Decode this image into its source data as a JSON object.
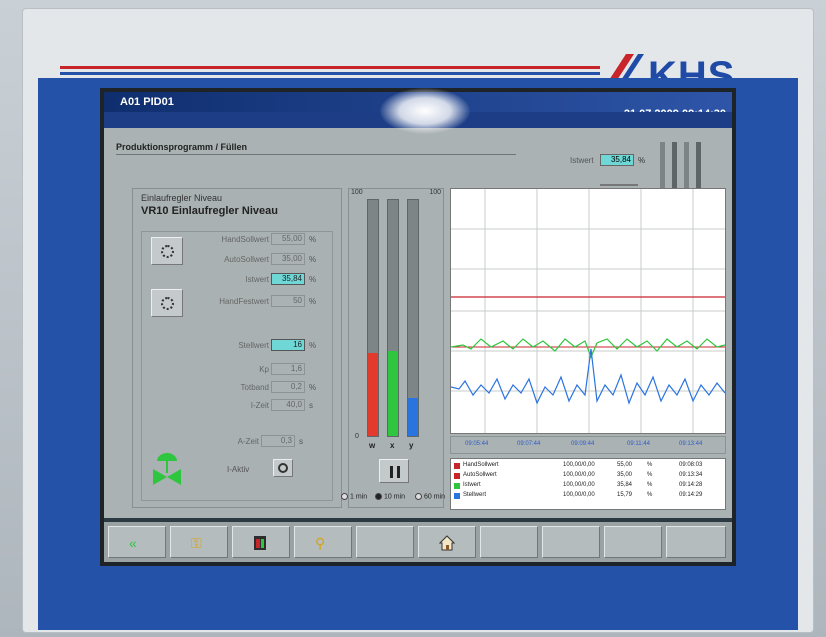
{
  "brand": {
    "name": "KHS",
    "stripe_blue": "#2452a8",
    "stripe_red": "#c8252b"
  },
  "window": {
    "title": "A01 PID01",
    "datetime": "21.07.2009 09:14:30"
  },
  "section_title": "Produktionsprogramm / Füllen",
  "top_istwert": {
    "label": "Istwert",
    "value": "35,84",
    "unit": "%"
  },
  "controller": {
    "heading_small": "Einlaufregler Niveau",
    "heading_large": "VR10 Einlaufregler Niveau",
    "fields": [
      {
        "label": "HandSollwert",
        "value": "55,00",
        "unit": "%",
        "highlight": false
      },
      {
        "label": "AutoSollwert",
        "value": "35,00",
        "unit": "%",
        "highlight": false
      },
      {
        "label": "Istwert",
        "value": "35,84",
        "unit": "%",
        "highlight": true
      },
      {
        "label": "HandFestwert",
        "value": "50",
        "unit": "%",
        "highlight": false
      },
      {
        "label": "Stellwert",
        "value": "16",
        "unit": "%",
        "highlight": true
      },
      {
        "label": "Kp",
        "value": "1,6",
        "unit": "",
        "highlight": false
      },
      {
        "label": "Totband",
        "value": "0,2",
        "unit": "%",
        "highlight": false
      },
      {
        "label": "I-Zeit",
        "value": "40,0",
        "unit": "s",
        "highlight": false
      },
      {
        "label": "A-Zeit",
        "value": "0,3",
        "unit": "s",
        "highlight": false
      }
    ],
    "i_aktiv_label": "I-Aktiv"
  },
  "bargraph": {
    "scale_top": "100",
    "scale_bottom": "0",
    "bars": [
      {
        "label": "w",
        "percent": 35,
        "color": "#e23b2e"
      },
      {
        "label": "x",
        "percent": 36,
        "color": "#2fc63f"
      },
      {
        "label": "y",
        "percent": 16,
        "color": "#2a74e0"
      }
    ],
    "timespans": [
      {
        "label": "1 min",
        "selected": false
      },
      {
        "label": "10 min",
        "selected": true
      },
      {
        "label": "60 min",
        "selected": false
      }
    ]
  },
  "trend": {
    "time_ticks": [
      "09:05:44",
      "09:07:44",
      "09:09:44",
      "09:11:44",
      "09:13:44"
    ],
    "series": [
      {
        "name": "HandSollwert",
        "range": "100,00/0,00",
        "value": "55,00",
        "unit": "%",
        "time": "09:08:03",
        "color": "#c8252b"
      },
      {
        "name": "AutoSollwert",
        "range": "100,00/0,00",
        "value": "35,00",
        "unit": "%",
        "time": "09:13:34",
        "color": "#c8252b"
      },
      {
        "name": "Istwert",
        "range": "100,00/0,00",
        "value": "35,84",
        "unit": "%",
        "time": "09:14:28",
        "color": "#2fc63f"
      },
      {
        "name": "Stellwert",
        "range": "100,00/0,00",
        "value": "15,79",
        "unit": "%",
        "time": "09:14:29",
        "color": "#2a74e0"
      }
    ]
  },
  "toolbar": {
    "icons": [
      "double-arrow-left-icon",
      "keys-icon",
      "panel-icon",
      "key-icon",
      "blank",
      "blank",
      "home-icon",
      "blank",
      "blank",
      "blank"
    ]
  }
}
